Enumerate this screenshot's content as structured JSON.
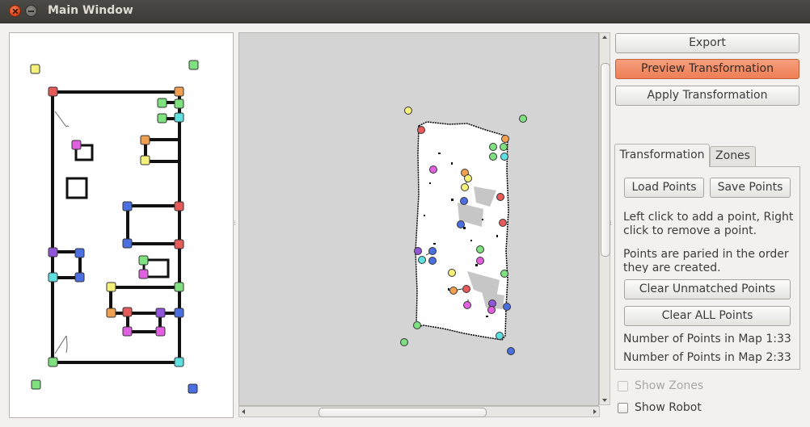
{
  "window": {
    "title": "Main Window"
  },
  "toolbar": {
    "export_label": "Export",
    "preview_label": "Preview Transformation",
    "apply_label": "Apply Transformation"
  },
  "tabs": [
    {
      "label": "Transformation",
      "active": true
    },
    {
      "label": "Zones",
      "active": false
    }
  ],
  "transformation": {
    "load_label": "Load Points",
    "save_label": "Save Points",
    "help_line1": "Left click to add a point, Right",
    "help_line2": "click to remove a point.",
    "note_line1": "Points are paried in the order",
    "note_line2": "they are created.",
    "clear_unmatched_label": "Clear Unmatched Points",
    "clear_all_label": "Clear ALL Points",
    "map1_count_label": "Number of Points in Map 1:",
    "map1_count": "33",
    "map2_count_label": "Number of Points in Map 2:",
    "map2_count": "33"
  },
  "options": {
    "show_zones_label": "Show Zones",
    "show_zones_enabled": false,
    "show_robot_label": "Show Robot",
    "show_robot_checked": false
  },
  "colors": {
    "accent": "#ef7e55",
    "marker_red": "#e65a5a",
    "marker_orange": "#f0a050",
    "marker_yellow": "#f5f07a",
    "marker_green": "#7fe07f",
    "marker_cyan": "#5fe0e0",
    "marker_blue": "#4b6fe0",
    "marker_purple": "#9055d8",
    "marker_magenta": "#e060e0"
  }
}
